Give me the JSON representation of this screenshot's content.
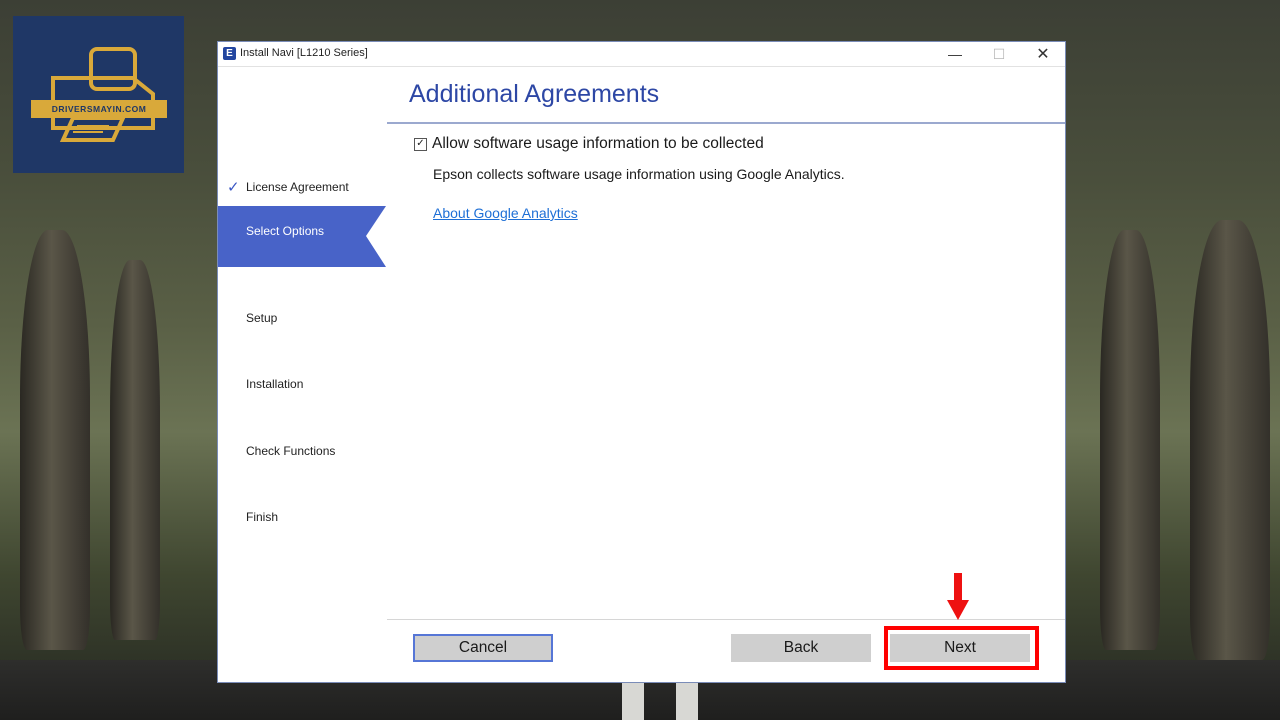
{
  "logo": {
    "text": "DRIVERSMAYIN.COM"
  },
  "window": {
    "title": "Install Navi [L1210 Series]",
    "controls": {
      "minimize": "—",
      "maximize": "☐",
      "close": "✕"
    }
  },
  "sidebar": {
    "steps": [
      {
        "label": "License Agreement",
        "state": "completed",
        "check": "✓"
      },
      {
        "label": "Select Options",
        "state": "active"
      },
      {
        "label": "Setup",
        "state": "pending"
      },
      {
        "label": "Installation",
        "state": "pending"
      },
      {
        "label": "Check Functions",
        "state": "pending"
      },
      {
        "label": "Finish",
        "state": "pending"
      }
    ]
  },
  "main": {
    "title": "Additional Agreements",
    "consent": {
      "checked": true,
      "check_glyph": "✓",
      "label": "Allow software usage information to be collected"
    },
    "description": "Epson collects software usage information using Google Analytics.",
    "link": "About Google Analytics"
  },
  "footer": {
    "cancel_label": "Cancel",
    "back_label": "Back",
    "next_label": "Next"
  },
  "colors": {
    "accent": "#4863c8",
    "title": "#2d47a5",
    "link": "#1e6fd6",
    "highlight": "#ff0000"
  }
}
